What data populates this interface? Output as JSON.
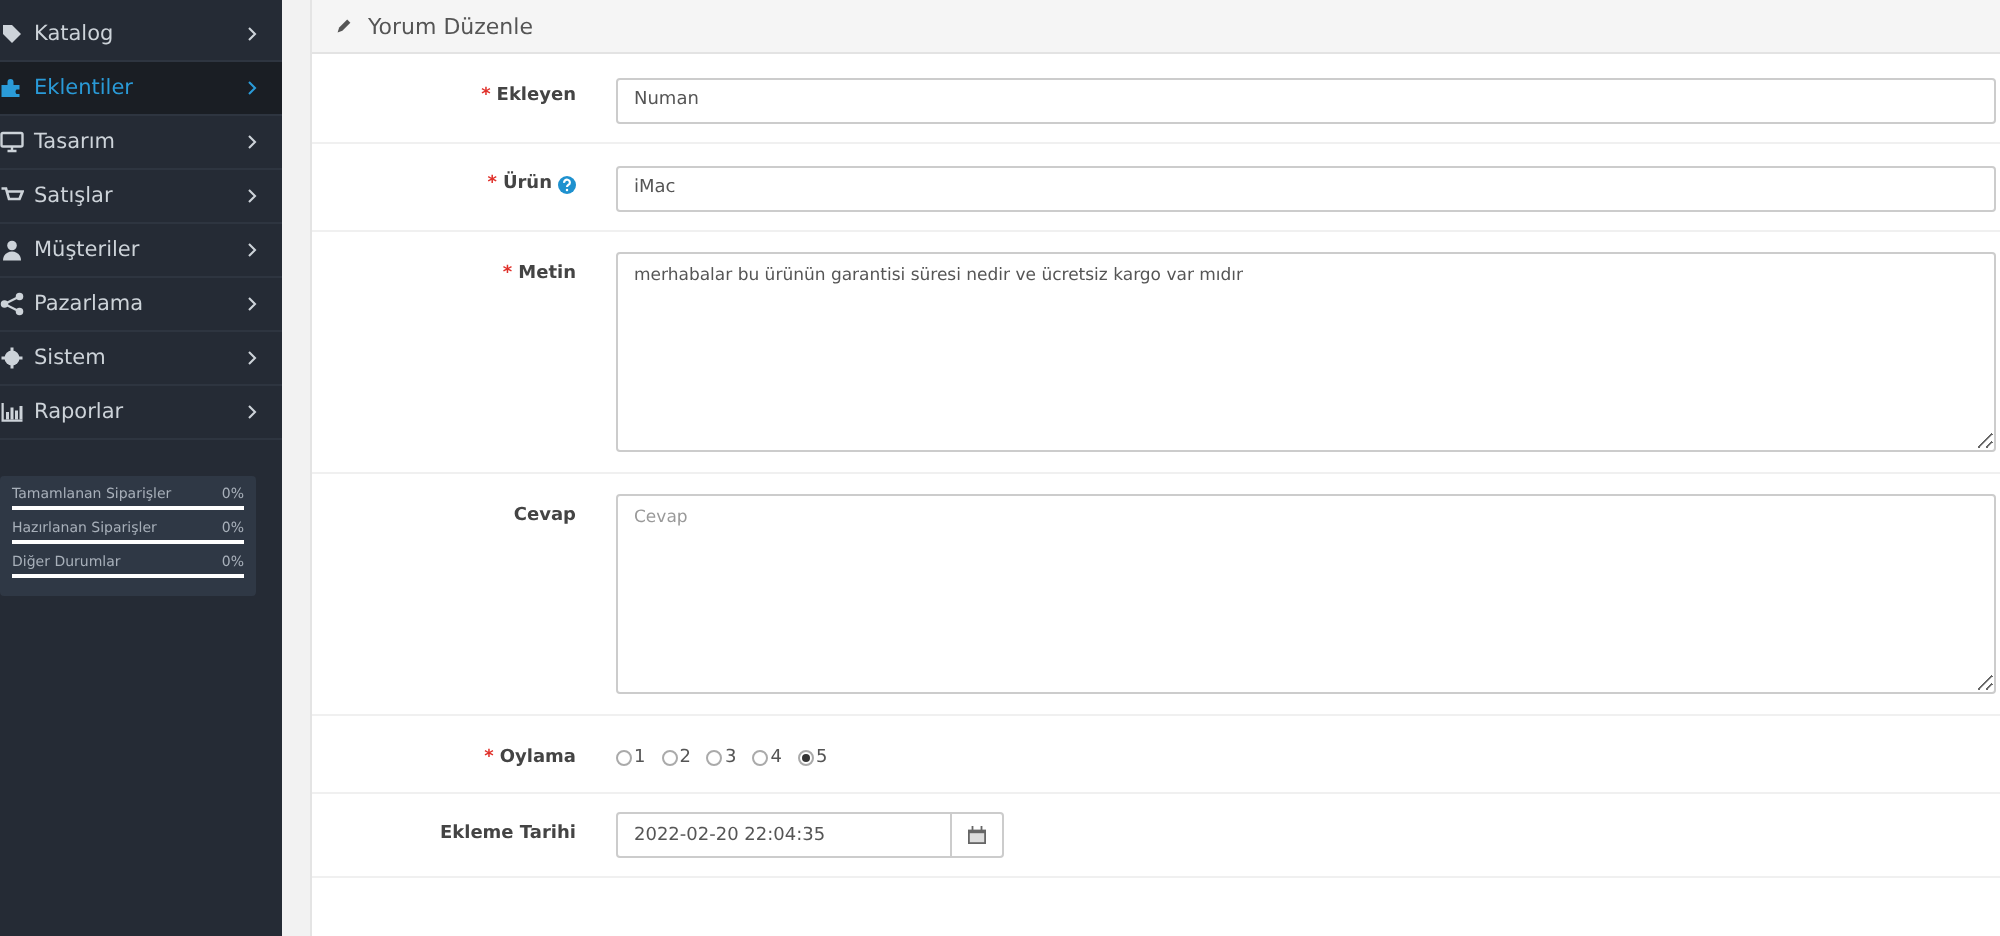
{
  "sidebar": {
    "items": [
      {
        "label": "Katalog",
        "selected": false
      },
      {
        "label": "Eklentiler",
        "selected": true
      },
      {
        "label": "Tasarım",
        "selected": false
      },
      {
        "label": "Satışlar",
        "selected": false
      },
      {
        "label": "Müşteriler",
        "selected": false
      },
      {
        "label": "Pazarlama",
        "selected": false
      },
      {
        "label": "Sistem",
        "selected": false
      },
      {
        "label": "Raporlar",
        "selected": false
      }
    ],
    "stats": [
      {
        "label": "Tamamlanan Siparişler",
        "reading": "0%",
        "level": 0
      },
      {
        "label": "Hazırlanan Siparişler",
        "reading": "0%",
        "level": 0
      },
      {
        "label": "Diğer Durumlar",
        "reading": "0%",
        "level": 0
      }
    ]
  },
  "panel": {
    "title": "Yorum Düzenle",
    "fields": [
      {
        "kind": "input",
        "marker": "*",
        "label": "Ekleyen",
        "value": "Numan"
      },
      {
        "kind": "input",
        "marker": "*",
        "label": "Ürün",
        "help": true,
        "value": "iMac"
      },
      {
        "kind": "textarea",
        "marker": "*",
        "label": "Metin",
        "value": "merhabalar bu ürünün garantisi süresi nedir ve ücretsiz kargo var mıdır"
      },
      {
        "kind": "textarea",
        "label": "Cevap",
        "placeholder": "Cevap"
      },
      {
        "kind": "radio",
        "marker": "*",
        "label": "Oylama",
        "options": [
          {
            "label": "1",
            "selected": false
          },
          {
            "label": "2",
            "selected": false
          },
          {
            "label": "3",
            "selected": false
          },
          {
            "label": "4",
            "selected": false
          },
          {
            "label": "5",
            "selected": true
          }
        ]
      },
      {
        "kind": "date",
        "label": "Ekleme Tarihi",
        "value": "2022-02-20 22:04:35"
      }
    ]
  }
}
